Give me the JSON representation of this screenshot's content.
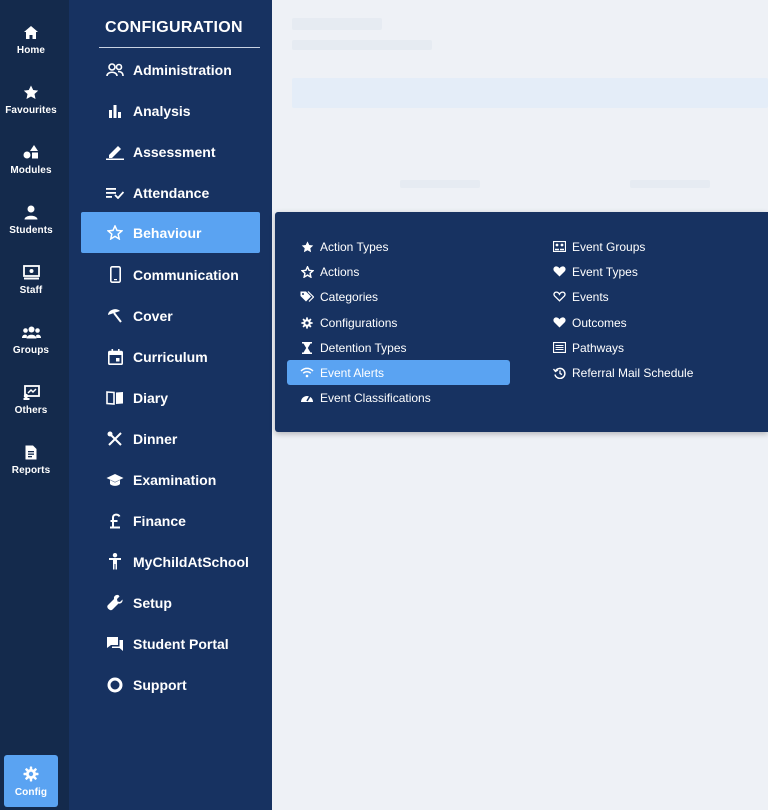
{
  "rail": {
    "items": [
      {
        "label": "Home",
        "icon": "home-icon"
      },
      {
        "label": "Favourites",
        "icon": "star-icon"
      },
      {
        "label": "Modules",
        "icon": "shapes-icon"
      },
      {
        "label": "Students",
        "icon": "user-icon"
      },
      {
        "label": "Staff",
        "icon": "teacher-icon"
      },
      {
        "label": "Groups",
        "icon": "users-icon"
      },
      {
        "label": "Others",
        "icon": "presentation-icon"
      },
      {
        "label": "Reports",
        "icon": "file-icon"
      }
    ],
    "active": {
      "label": "Config",
      "icon": "gear-icon"
    }
  },
  "config": {
    "title": "CONFIGURATION",
    "items": [
      {
        "label": "Administration",
        "icon": "people-outline-icon"
      },
      {
        "label": "Analysis",
        "icon": "bar-chart-icon"
      },
      {
        "label": "Assessment",
        "icon": "pen-icon"
      },
      {
        "label": "Attendance",
        "icon": "checklist-icon"
      },
      {
        "label": "Behaviour",
        "icon": "star-outline-icon"
      },
      {
        "label": "Communication",
        "icon": "phone-icon"
      },
      {
        "label": "Cover",
        "icon": "umbrella-icon"
      },
      {
        "label": "Curriculum",
        "icon": "calendar-icon"
      },
      {
        "label": "Diary",
        "icon": "book-icon"
      },
      {
        "label": "Dinner",
        "icon": "utensils-icon"
      },
      {
        "label": "Examination",
        "icon": "graduation-cap-icon"
      },
      {
        "label": "Finance",
        "icon": "pound-icon"
      },
      {
        "label": "MyChildAtSchool",
        "icon": "child-icon"
      },
      {
        "label": "Setup",
        "icon": "wrench-icon"
      },
      {
        "label": "Student Portal",
        "icon": "chat-icon"
      },
      {
        "label": "Support",
        "icon": "circle-icon"
      }
    ]
  },
  "flyout": {
    "left": [
      {
        "label": "Action Types",
        "icon": "star-icon"
      },
      {
        "label": "Actions",
        "icon": "star-outline-icon"
      },
      {
        "label": "Categories",
        "icon": "tags-icon"
      },
      {
        "label": "Configurations",
        "icon": "gear-icon"
      },
      {
        "label": "Detention Types",
        "icon": "hourglass-icon"
      },
      {
        "label": "Event Alerts",
        "icon": "wifi-icon"
      },
      {
        "label": "Event Classifications",
        "icon": "gauge-icon"
      }
    ],
    "right": [
      {
        "label": "Event Groups",
        "icon": "group-box-icon"
      },
      {
        "label": "Event Types",
        "icon": "heart-icon"
      },
      {
        "label": "Events",
        "icon": "heart-outline-icon"
      },
      {
        "label": "Outcomes",
        "icon": "heart-icon"
      },
      {
        "label": "Pathways",
        "icon": "list-box-icon"
      },
      {
        "label": "Referral Mail Schedule",
        "icon": "history-icon"
      }
    ]
  },
  "colors": {
    "rail_bg": "#142a4c",
    "panel_bg": "#173261",
    "accent": "#5aa3f2",
    "page_bg": "#eef1f6"
  }
}
